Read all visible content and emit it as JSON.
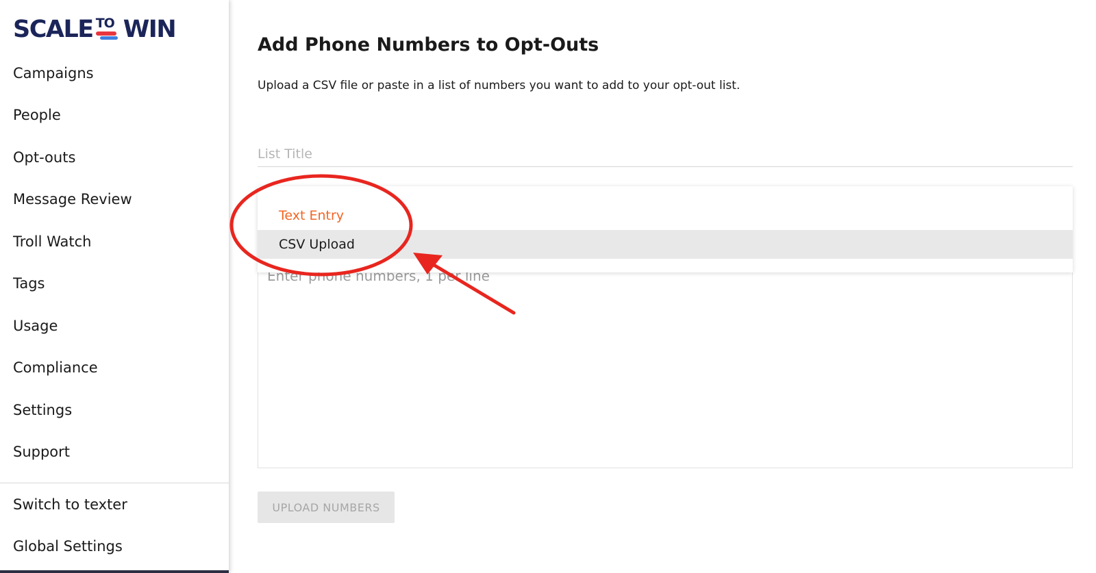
{
  "brand": {
    "logo_left": "SCALE",
    "logo_middle": "TO",
    "logo_right": "WIN",
    "colors": {
      "navy": "#1b2559",
      "red": "#e8363f",
      "blue": "#3f7fe0",
      "accent_orange": "#f26522",
      "annotation_red": "#e8261f"
    }
  },
  "sidebar": {
    "items": [
      {
        "label": "Campaigns"
      },
      {
        "label": "People"
      },
      {
        "label": "Opt-outs"
      },
      {
        "label": "Message Review"
      },
      {
        "label": "Troll Watch"
      },
      {
        "label": "Tags"
      },
      {
        "label": "Usage"
      },
      {
        "label": "Compliance"
      },
      {
        "label": "Settings"
      },
      {
        "label": "Support"
      }
    ],
    "bottom_items": [
      {
        "label": "Switch to texter"
      },
      {
        "label": "Global Settings"
      }
    ]
  },
  "main": {
    "title": "Add Phone Numbers to Opt-Outs",
    "description": "Upload a CSV file or paste in a list of numbers you want to add to your opt-out list.",
    "list_title_placeholder": "List Title",
    "textarea_placeholder": "Enter phone numbers, 1 per line",
    "upload_button": "UPLOAD NUMBERS",
    "entry_mode_dropdown": {
      "options": [
        {
          "label": "Text Entry",
          "selected": true
        },
        {
          "label": "CSV Upload",
          "highlighted": true
        }
      ]
    }
  }
}
